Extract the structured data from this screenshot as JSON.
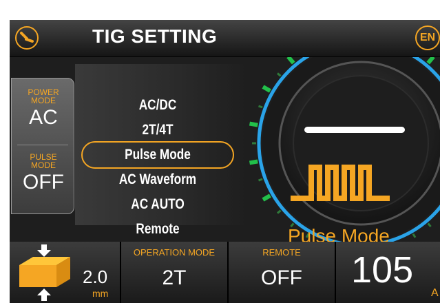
{
  "header": {
    "title": "TIG SETTING",
    "lang_badge": "EN",
    "torch_icon": "torch-icon",
    "accent": "#f5a623"
  },
  "left_panel": {
    "power_mode_label_1": "POWER",
    "power_mode_label_2": "MODE",
    "power_mode_value": "AC",
    "pulse_mode_label_1": "PULSE",
    "pulse_mode_label_2": "MODE",
    "pulse_mode_value": "OFF"
  },
  "menu": {
    "items": [
      "AC/DC",
      "2T/4T",
      "Pulse Mode",
      "AC Waveform",
      "AC AUTO",
      "Remote"
    ],
    "selected": "Pulse Mode"
  },
  "dial": {
    "label": "Pulse Mode",
    "icon": "pulse-wave-icon"
  },
  "bottom": {
    "thickness_value": "2.0",
    "thickness_unit": "mm",
    "operation_mode_label": "OPERATION MODE",
    "operation_mode_value": "2T",
    "remote_label": "REMOTE",
    "remote_value": "OFF",
    "current_value": "105",
    "current_unit": "A"
  }
}
